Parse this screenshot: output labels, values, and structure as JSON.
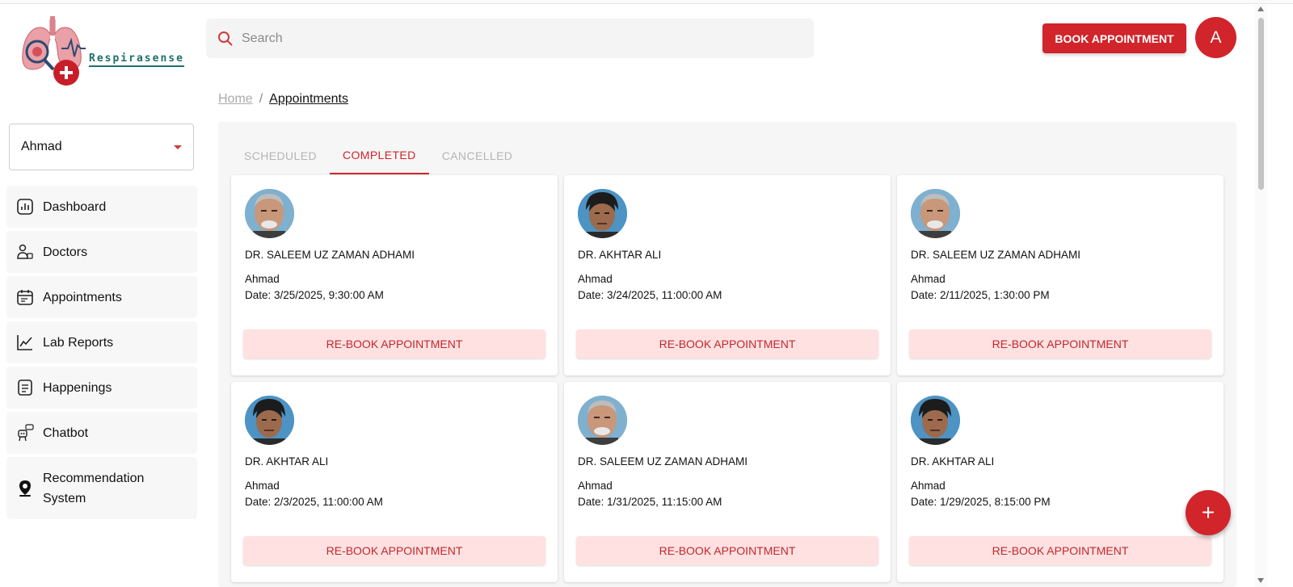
{
  "brand": {
    "name": "Respirasense"
  },
  "user_select": {
    "value": "Ahmad"
  },
  "sidebar": {
    "items": [
      {
        "label": "Dashboard",
        "icon": "dashboard-icon"
      },
      {
        "label": "Doctors",
        "icon": "doctors-icon"
      },
      {
        "label": "Appointments",
        "icon": "calendar-icon"
      },
      {
        "label": "Lab Reports",
        "icon": "chart-line-icon"
      },
      {
        "label": "Happenings",
        "icon": "document-icon"
      },
      {
        "label": "Chatbot",
        "icon": "chatbot-icon"
      },
      {
        "label": "Recommendation System",
        "icon": "location-pin-icon"
      }
    ]
  },
  "header": {
    "search_placeholder": "Search",
    "book_label": "BOOK APPOINTMENT",
    "avatar_initial": "A"
  },
  "breadcrumb": {
    "home": "Home",
    "sep": "/",
    "current": "Appointments"
  },
  "tabs": [
    {
      "label": "SCHEDULED",
      "active": false
    },
    {
      "label": "COMPLETED",
      "active": true
    },
    {
      "label": "CANCELLED",
      "active": false
    }
  ],
  "cards": [
    {
      "doctor": "DR. SALEEM UZ ZAMAN ADHAMI",
      "patient": "Ahmad",
      "date": "Date: 3/25/2025, 9:30:00 AM",
      "action": "RE-BOOK APPOINTMENT"
    },
    {
      "doctor": "DR. AKHTAR ALI",
      "patient": "Ahmad",
      "date": "Date: 3/24/2025, 11:00:00 AM",
      "action": "RE-BOOK APPOINTMENT"
    },
    {
      "doctor": "DR. SALEEM UZ ZAMAN ADHAMI",
      "patient": "Ahmad",
      "date": "Date: 2/11/2025, 1:30:00 PM",
      "action": "RE-BOOK APPOINTMENT"
    },
    {
      "doctor": "DR. AKHTAR ALI",
      "patient": "Ahmad",
      "date": "Date: 2/3/2025, 11:00:00 AM",
      "action": "RE-BOOK APPOINTMENT"
    },
    {
      "doctor": "DR. SALEEM UZ ZAMAN ADHAMI",
      "patient": "Ahmad",
      "date": "Date: 1/31/2025, 11:15:00 AM",
      "action": "RE-BOOK APPOINTMENT"
    },
    {
      "doctor": "DR. AKHTAR ALI",
      "patient": "Ahmad",
      "date": "Date: 1/29/2025, 8:15:00 PM",
      "action": "RE-BOOK APPOINTMENT"
    }
  ],
  "fab": {
    "symbol": "+"
  },
  "colors": {
    "accent": "#d1242b",
    "accent_soft": "#ffe1e1",
    "brand_teal": "#1f6f6a"
  }
}
